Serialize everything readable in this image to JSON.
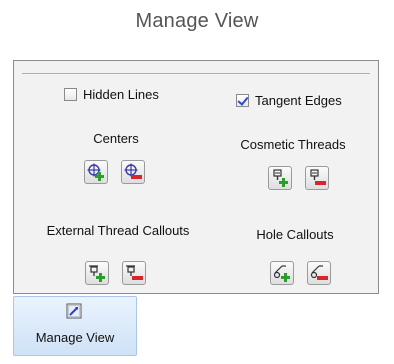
{
  "header": {
    "title": "Manage View"
  },
  "panel": {
    "hidden_lines": {
      "label": "Hidden Lines",
      "checked": false
    },
    "tangent_edges": {
      "label": "Tangent Edges",
      "checked": true
    },
    "centers": {
      "label": "Centers"
    },
    "cosmetic_threads": {
      "label": "Cosmetic Threads"
    },
    "external_thread_callouts": {
      "label": "External Thread Callouts"
    },
    "hole_callouts": {
      "label": "Hole Callouts"
    }
  },
  "footer_button": {
    "label": "Manage View",
    "icon": "manage-view-icon"
  },
  "colors": {
    "add": "#2a9d2a",
    "remove": "#d6262a",
    "accent": "#cfe2f7"
  }
}
